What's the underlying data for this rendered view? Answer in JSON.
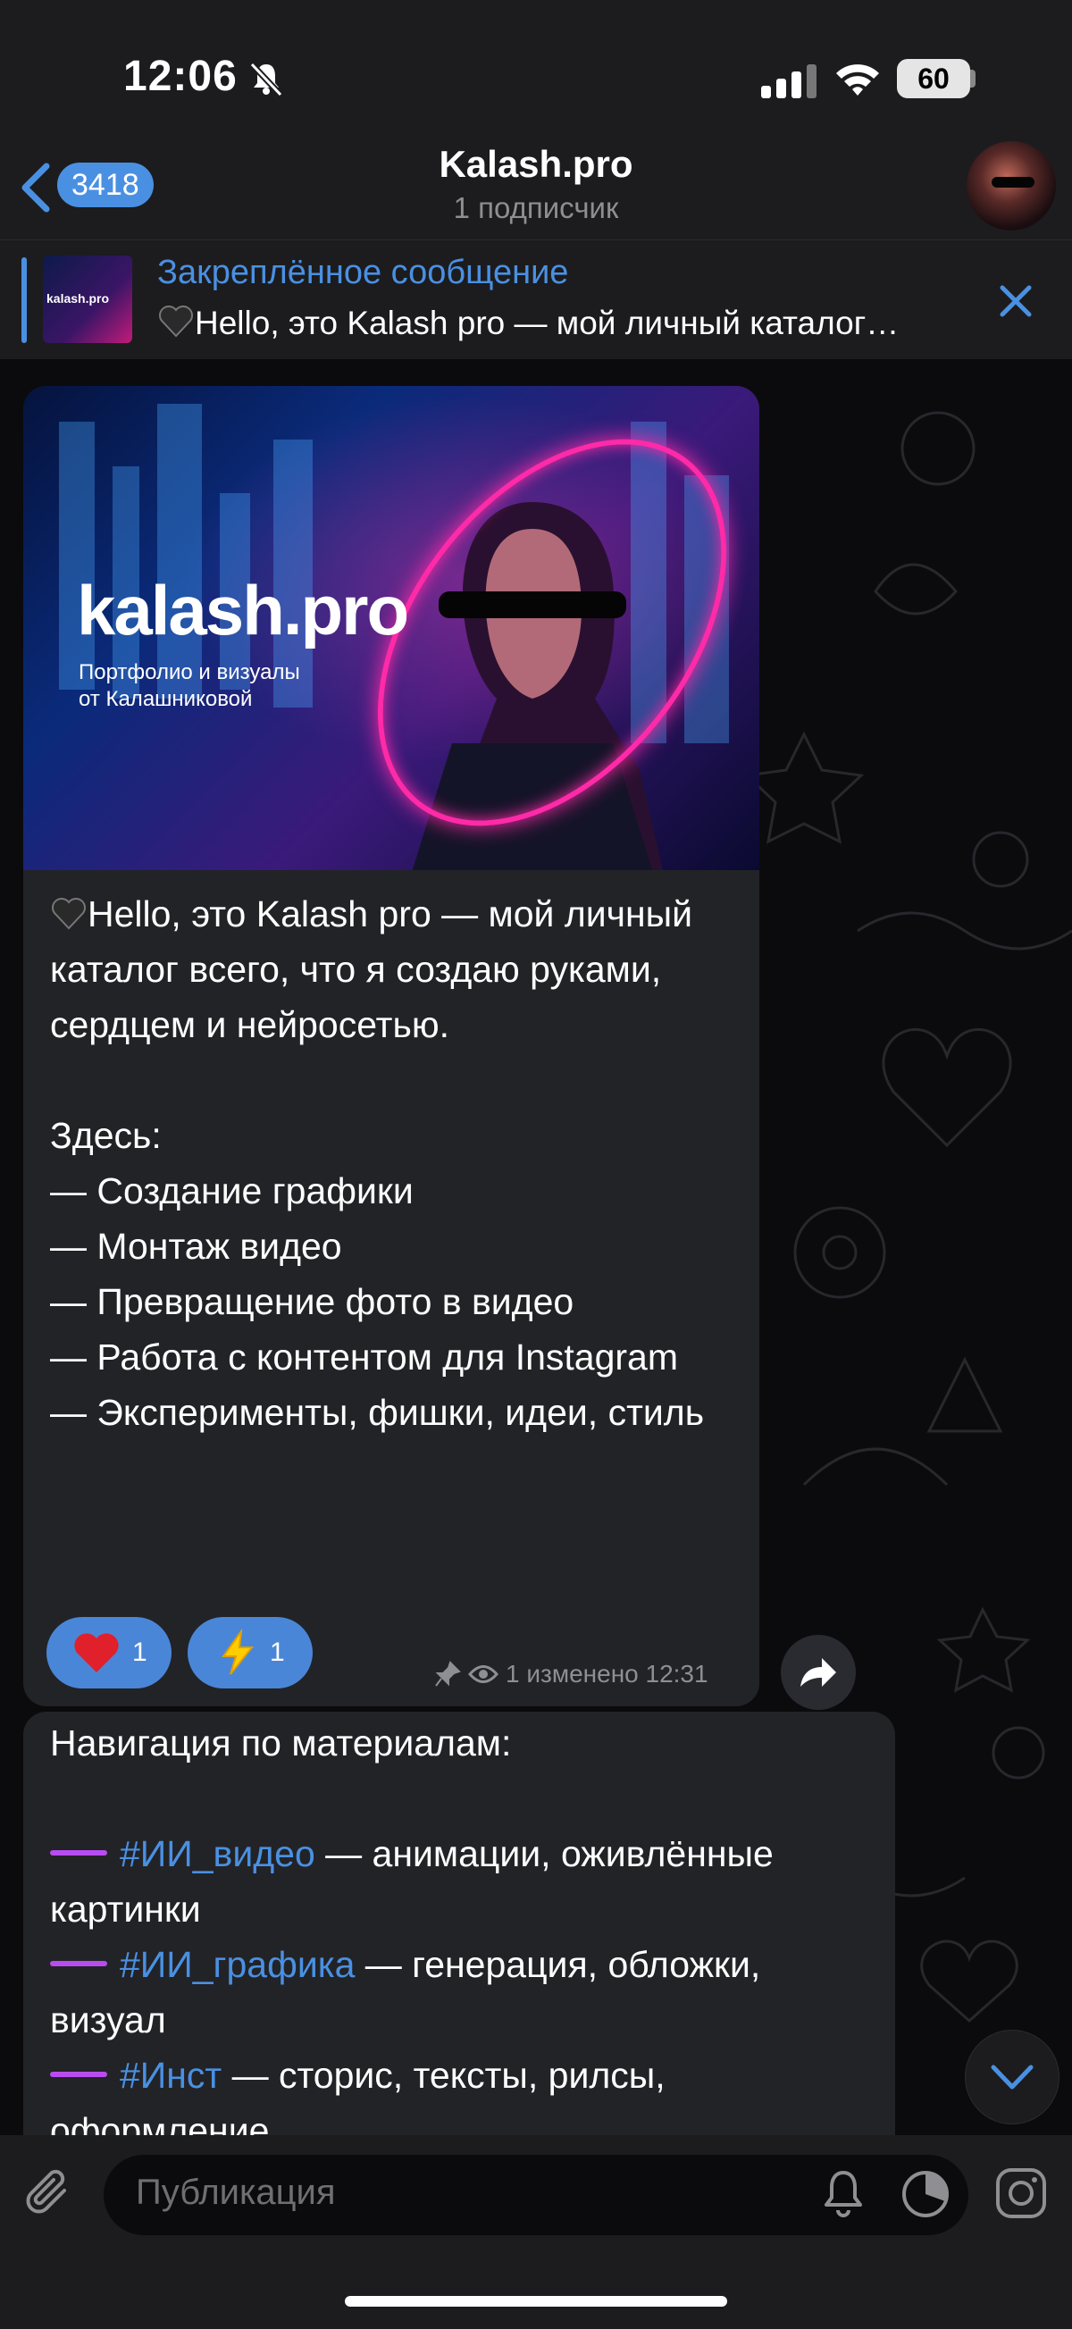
{
  "status_bar": {
    "time": "12:06",
    "battery": "60"
  },
  "header": {
    "back_count": "3418",
    "title": "Kalash.pro",
    "subtitle": "1 подписчик"
  },
  "pinned": {
    "label": "Закреплённое сообщение",
    "text": "Hello, это Kalash pro — мой личный каталог…",
    "thumb_text": "kalash.pro"
  },
  "post1": {
    "image": {
      "brand": "kalash.pro",
      "sub_line1": "Портфолио и визуалы",
      "sub_line2": "от Калашниковой"
    },
    "paragraph1": "Hello, это Kalash pro — мой личный каталог всего, что я создаю руками, сердцем и нейросетью.",
    "here": "Здесь:",
    "items": [
      "— Создание графики",
      "— Монтаж видео",
      "— Превращение фото в видео",
      "— Работа с контентом для Instagram",
      "— Эксперименты, фишки, идеи, стиль"
    ],
    "reactions": [
      {
        "emoji": "heart",
        "count": "1"
      },
      {
        "emoji": "lightning",
        "count": "1"
      }
    ],
    "meta": "1 изменено 12:31"
  },
  "post2": {
    "heading": "Навигация по материалам:",
    "entries": [
      {
        "tag": "#ИИ_видео",
        "text": " — анимации, оживлённые",
        "cont": "картинки"
      },
      {
        "tag": "#ИИ_графика",
        "text": " — генерация, обложки,",
        "cont": "визуал"
      },
      {
        "tag": "#Инст",
        "text": " — сторис, тексты, рилсы,",
        "cont": "оформление"
      }
    ]
  },
  "input": {
    "placeholder": "Публикация"
  },
  "colors": {
    "accent": "#4a90e2",
    "bubble": "#222327",
    "dash": "#b84cf0",
    "neon": "#ff2aa8"
  }
}
